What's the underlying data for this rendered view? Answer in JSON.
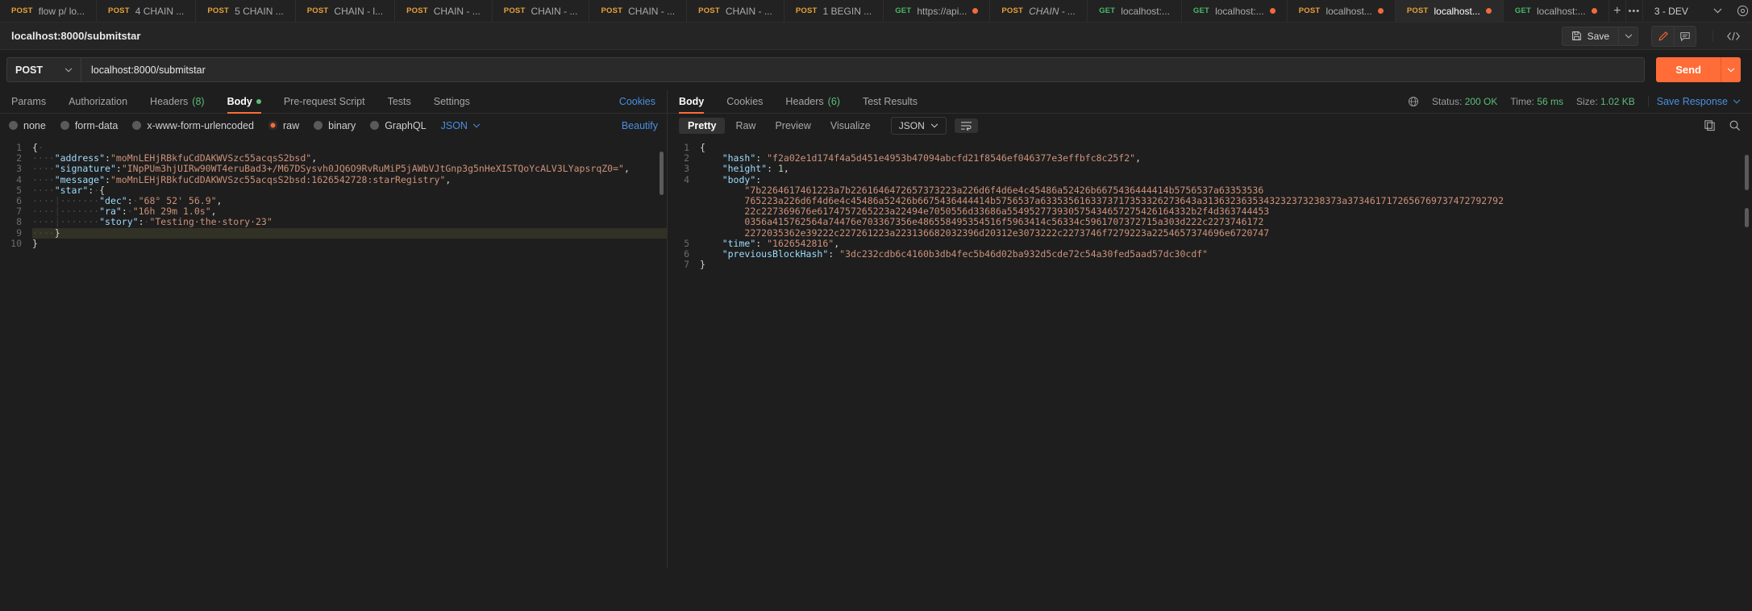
{
  "tabs": [
    {
      "method": "POST",
      "label": "flow p/ lo...",
      "unsaved": false,
      "active": false,
      "italic": false
    },
    {
      "method": "POST",
      "label": "4 CHAIN ...",
      "unsaved": false,
      "active": false,
      "italic": false
    },
    {
      "method": "POST",
      "label": "5 CHAIN ...",
      "unsaved": false,
      "active": false,
      "italic": false
    },
    {
      "method": "POST",
      "label": "CHAIN - l...",
      "unsaved": false,
      "active": false,
      "italic": false
    },
    {
      "method": "POST",
      "label": "CHAIN - ...",
      "unsaved": false,
      "active": false,
      "italic": false
    },
    {
      "method": "POST",
      "label": "CHAIN - ...",
      "unsaved": false,
      "active": false,
      "italic": false
    },
    {
      "method": "POST",
      "label": "CHAIN - ...",
      "unsaved": false,
      "active": false,
      "italic": false
    },
    {
      "method": "POST",
      "label": "CHAIN - ...",
      "unsaved": false,
      "active": false,
      "italic": false
    },
    {
      "method": "POST",
      "label": "1 BEGIN ...",
      "unsaved": false,
      "active": false,
      "italic": false
    },
    {
      "method": "GET",
      "label": "https://api...",
      "unsaved": true,
      "active": false,
      "italic": false
    },
    {
      "method": "POST",
      "label": "CHAIN - ...",
      "unsaved": false,
      "active": false,
      "italic": true
    },
    {
      "method": "GET",
      "label": "localhost:...",
      "unsaved": false,
      "active": false,
      "italic": false
    },
    {
      "method": "GET",
      "label": "localhost:...",
      "unsaved": true,
      "active": false,
      "italic": false
    },
    {
      "method": "POST",
      "label": "localhost...",
      "unsaved": true,
      "active": false,
      "italic": false
    },
    {
      "method": "POST",
      "label": "localhost...",
      "unsaved": true,
      "active": true,
      "italic": false
    },
    {
      "method": "GET",
      "label": "localhost:...",
      "unsaved": true,
      "active": false,
      "italic": false
    }
  ],
  "tabstrip": {
    "new_tab": "+",
    "more": "•••",
    "environment": "3 - DEV"
  },
  "request_header": {
    "title": "localhost:8000/submitstar",
    "save_label": "Save"
  },
  "url_bar": {
    "method": "POST",
    "url": "localhost:8000/submitstar",
    "send_label": "Send"
  },
  "request_tabs": [
    {
      "label": "Params",
      "count": null,
      "dot": false,
      "active": false
    },
    {
      "label": "Authorization",
      "count": null,
      "dot": false,
      "active": false
    },
    {
      "label": "Headers",
      "count": "(8)",
      "dot": false,
      "active": false
    },
    {
      "label": "Body",
      "count": null,
      "dot": true,
      "active": true
    },
    {
      "label": "Pre-request Script",
      "count": null,
      "dot": false,
      "active": false
    },
    {
      "label": "Tests",
      "count": null,
      "dot": false,
      "active": false
    },
    {
      "label": "Settings",
      "count": null,
      "dot": false,
      "active": false
    }
  ],
  "request_tabs_right": {
    "cookies": "Cookies"
  },
  "body_types": [
    {
      "label": "none",
      "selected": false
    },
    {
      "label": "form-data",
      "selected": false
    },
    {
      "label": "x-www-form-urlencoded",
      "selected": false
    },
    {
      "label": "raw",
      "selected": true
    },
    {
      "label": "binary",
      "selected": false
    },
    {
      "label": "GraphQL",
      "selected": false
    }
  ],
  "body_format": "JSON",
  "beautify_label": "Beautify",
  "request_body": {
    "line_count": 10,
    "highlighted_line": 9,
    "address": "moMnLEHjRBkfuCdDAKWVSzc55acqsS2bsd",
    "signature": "INpPUm3hjUIRw90WT4eruBad3+/M67DSysvh0JQ6O9RvRuMiP5jAWbVJtGnp3g5nHeXISTQoYcALV3LYapsrqZ0=",
    "message": "moMnLEHjRBkfuCdDAKWVSzc55acqsS2bsd:1626542728:starRegistry",
    "star": {
      "dec": "68° 52' 56.9",
      "ra": "16h 29m 1.0s",
      "story": "Testing the story 23"
    }
  },
  "response_tabs": [
    {
      "label": "Body",
      "count": null,
      "active": true
    },
    {
      "label": "Cookies",
      "count": null,
      "active": false
    },
    {
      "label": "Headers",
      "count": "(6)",
      "active": false
    },
    {
      "label": "Test Results",
      "count": null,
      "active": false
    }
  ],
  "response_meta": {
    "status_label": "Status:",
    "status_value": "200 OK",
    "time_label": "Time:",
    "time_value": "56 ms",
    "size_label": "Size:",
    "size_value": "1.02 KB",
    "save_response": "Save Response"
  },
  "response_view_tabs": [
    {
      "label": "Pretty",
      "active": true
    },
    {
      "label": "Raw",
      "active": false
    },
    {
      "label": "Preview",
      "active": false
    },
    {
      "label": "Visualize",
      "active": false
    }
  ],
  "response_format": "JSON",
  "response_body": {
    "line_count": 7,
    "hash": "f2a02e1d174f4a5d451e4953b47094abcfd21f8546ef046377e3effbfc8c25f2",
    "height": "1",
    "body_hex_lines": [
      "7b2264617461223a7b2261646472657373223a226d6f4d6e4c45486a52426b6675436444414b5756537a63353536",
      "765223a226d6f4d6e4c45486a52426b6675436444414b5756537a6335356163373717353326273643a3136323635343232373238373a3734617172656769737472792792",
      "22c227369676e6174757265223a22494e7050556d33686a554952773930575434657275426164332b2f4d363744453",
      "0356a415762564a74476e703367356e486558495354516f5963414c56334c5961707372715a303d222c2273746172",
      "2272035362e39222c227261223a223136682032396d20312e3073222c2273746f7279223a2254657374696e6720747"
    ],
    "time": "1626542816",
    "previousBlockHash": "3dc232cdb6c4160b3db4fec5b46d02ba932d5cde72c54a30fed5aad57dc30cdf"
  },
  "colors": {
    "accent": "#ff6c37",
    "link": "#4a8fe0",
    "success": "#5bbd7a",
    "method_post": "#e8a13a",
    "method_get": "#49b66a"
  }
}
